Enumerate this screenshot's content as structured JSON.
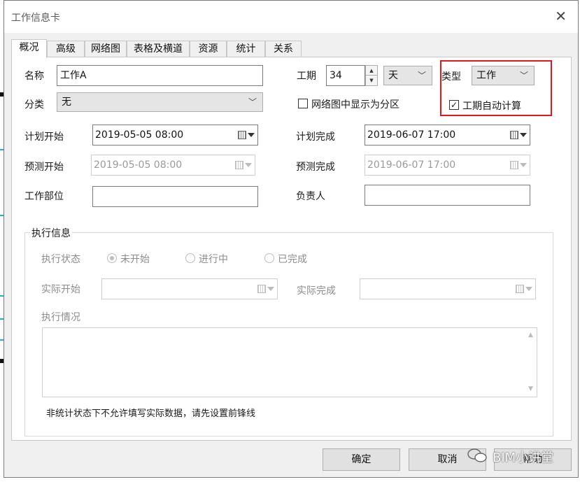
{
  "window": {
    "title": "工作信息卡",
    "close_glyph": "✕"
  },
  "tabs": [
    {
      "label": "概况",
      "active": true
    },
    {
      "label": "高级"
    },
    {
      "label": "网络图"
    },
    {
      "label": "表格及横道"
    },
    {
      "label": "资源"
    },
    {
      "label": "统计"
    },
    {
      "label": "关系"
    }
  ],
  "form": {
    "name_label": "名称",
    "name_value": "工作A",
    "category_label": "分类",
    "category_value": "无",
    "duration_label": "工期",
    "duration_value": "34",
    "duration_unit": "天",
    "type_label": "类型",
    "type_value": "工作",
    "auto_calc_label": "工期自动计算",
    "auto_calc_checked": true,
    "show_as_partition_label": "网络图中显示为分区",
    "show_as_partition_checked": false,
    "plan_start_label": "计划开始",
    "plan_start_value": "2019-05-05 08:00",
    "plan_finish_label": "计划完成",
    "plan_finish_value": "2019-06-07 17:00",
    "forecast_start_label": "预测开始",
    "forecast_start_value": "2019-05-05 08:00",
    "forecast_finish_label": "预测完成",
    "forecast_finish_value": "2019-06-07 17:00",
    "location_label": "工作部位",
    "location_value": "",
    "owner_label": "负责人",
    "owner_value": ""
  },
  "execution": {
    "group_title": "执行信息",
    "status_label": "执行状态",
    "status_options": [
      "未开始",
      "进行中",
      "已完成"
    ],
    "status_selected": "未开始",
    "actual_start_label": "实际开始",
    "actual_finish_label": "实际完成",
    "situation_label": "执行情况",
    "note": "非统计状态下不允许填写实际数据，请先设置前锋线"
  },
  "buttons": {
    "ok": "确定",
    "cancel": "取消",
    "help": "帮助"
  },
  "watermark": "BIM小讲堂",
  "colors": {
    "highlight": "#e01818",
    "accent": "#19b4d0"
  }
}
